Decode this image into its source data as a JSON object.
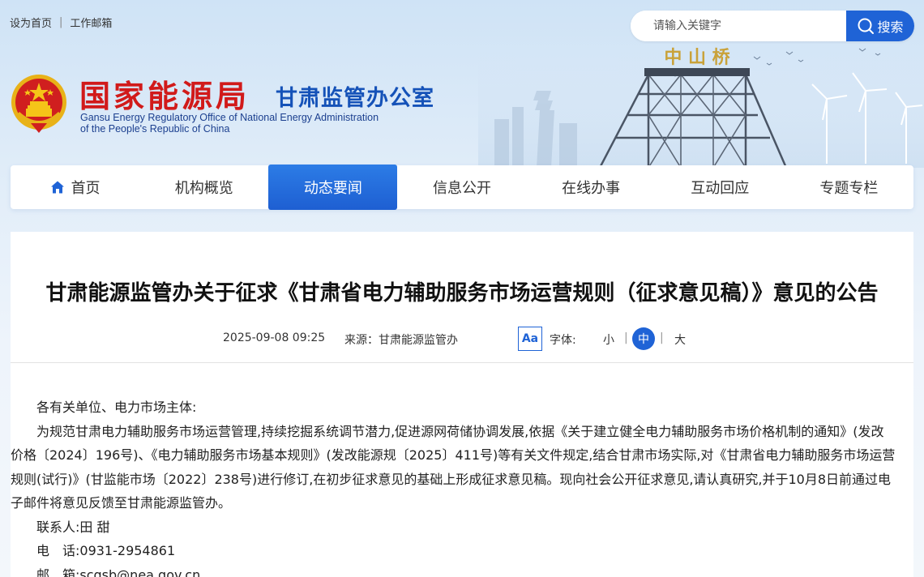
{
  "topbar": {
    "home_link": "设为首页",
    "separator": "|",
    "mail_link": "工作邮箱"
  },
  "search": {
    "placeholder": "请输入关键字",
    "button_label": "搜索"
  },
  "header": {
    "title_cn": "国家能源局",
    "subtitle_cn": "甘肃监管办公室",
    "title_en_line1": "Gansu Energy Regulatory Office of National Energy Administration",
    "title_en_line2": "of the People's Republic of China",
    "banner_text": "中 山 桥"
  },
  "nav": {
    "items": [
      {
        "label": "首页",
        "icon": "home-icon"
      },
      {
        "label": "机构概览"
      },
      {
        "label": "动态要闻",
        "active": true
      },
      {
        "label": "信息公开"
      },
      {
        "label": "在线办事"
      },
      {
        "label": "互动回应"
      },
      {
        "label": "专题专栏"
      }
    ]
  },
  "article": {
    "title": "甘肃能源监管办关于征求《甘肃省电力辅助服务市场运营规则（征求意见稿）》意见的公告",
    "date": "2025-09-08 09:25",
    "source": "来源：甘肃能源监管办",
    "font_toggle_icon": "Aa",
    "font_label": "字体:",
    "font_small": "小",
    "font_medium": "中",
    "font_large": "大",
    "font_sep": "|",
    "greeting": "各有关单位、电力市场主体:",
    "body": "为规范甘肃电力辅助服务市场运营管理,持续挖掘系统调节潜力,促进源网荷储协调发展,依据《关于建立健全电力辅助服务市场价格机制的通知》(发改价格〔2024〕196号)、《电力辅助服务市场基本规则》(发改能源规〔2025〕411号)等有关文件规定,结合甘肃市场实际,对《甘肃省电力辅助服务市场运营规则(试行)》(甘监能市场〔2022〕238号)进行修订,在初步征求意见的基础上形成征求意见稿。现向社会公开征求意见,请认真研究,并于10月8日前通过电子邮件将意见反馈至甘肃能源监管办。",
    "contact": "联系人:田 甜",
    "phone": "电　话:0931-2954861",
    "email": "邮　箱:scgsb@nea.gov.cn"
  },
  "colors": {
    "brand_red": "#d11a1a",
    "brand_blue": "#1f63d6",
    "nav_active": "#1e5fd2"
  }
}
